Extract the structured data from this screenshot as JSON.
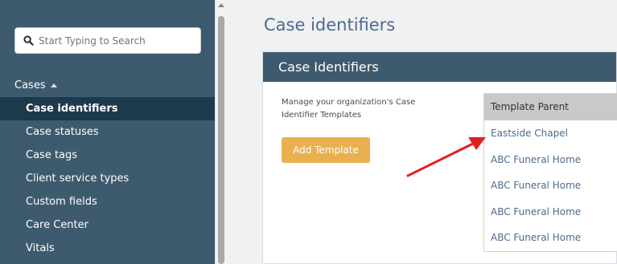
{
  "sidebar": {
    "search_placeholder": "Start Typing to Search",
    "section_label": "Cases",
    "items": [
      {
        "label": "Case identifiers",
        "active": true
      },
      {
        "label": "Case statuses"
      },
      {
        "label": "Case tags"
      },
      {
        "label": "Client service types"
      },
      {
        "label": "Custom fields"
      },
      {
        "label": "Care Center"
      },
      {
        "label": "Vitals"
      }
    ]
  },
  "main": {
    "page_title": "Case identifiers",
    "card": {
      "header": "Case Identifiers",
      "description": "Manage your organization's Case Identifier Templates",
      "add_button_label": "Add Template",
      "table": {
        "header": "Template Parent",
        "rows": [
          "Eastside Chapel",
          "ABC Funeral Home",
          "ABC Funeral Home",
          "ABC Funeral Home",
          "ABC Funeral Home"
        ]
      }
    }
  },
  "annotation": {
    "arrow_color": "#e02020"
  }
}
